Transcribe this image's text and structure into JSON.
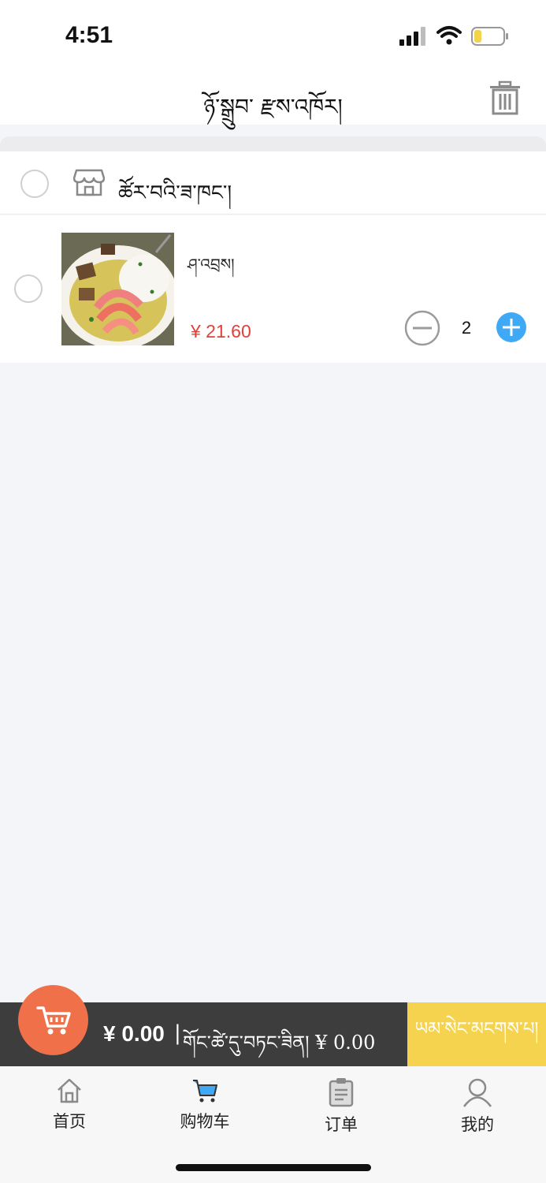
{
  "status_bar": {
    "time": "4:51"
  },
  "header": {
    "title": "ཉོ་སྒྲུབ་ རྫས་འཁོར།"
  },
  "shop": {
    "name": "ཚོར་བའི་ཟ་ཁང་།"
  },
  "cart_items": [
    {
      "name": "ཤ་འབྲས།",
      "price": "¥ 21.60",
      "quantity": "2"
    }
  ],
  "checkout": {
    "total": "¥ 0.00",
    "separator": "|",
    "delivery_label": "གོང་ཚེ་དུ་བཏང་ཟིན། ¥ 0.00",
    "checkout_label": "ཡམ་སེང་མངགས་པ།"
  },
  "tabs": [
    {
      "label": "首页",
      "icon": "home-icon"
    },
    {
      "label": "购物车",
      "icon": "cart-icon"
    },
    {
      "label": "订单",
      "icon": "clipboard-icon"
    },
    {
      "label": "我的",
      "icon": "user-icon"
    }
  ],
  "colors": {
    "price": "#e0413a",
    "accent_blue": "#3fa9f5",
    "checkout_yellow": "#f5d34f",
    "cart_orange": "#f0704a",
    "checkout_bar": "#3d3d3d"
  }
}
